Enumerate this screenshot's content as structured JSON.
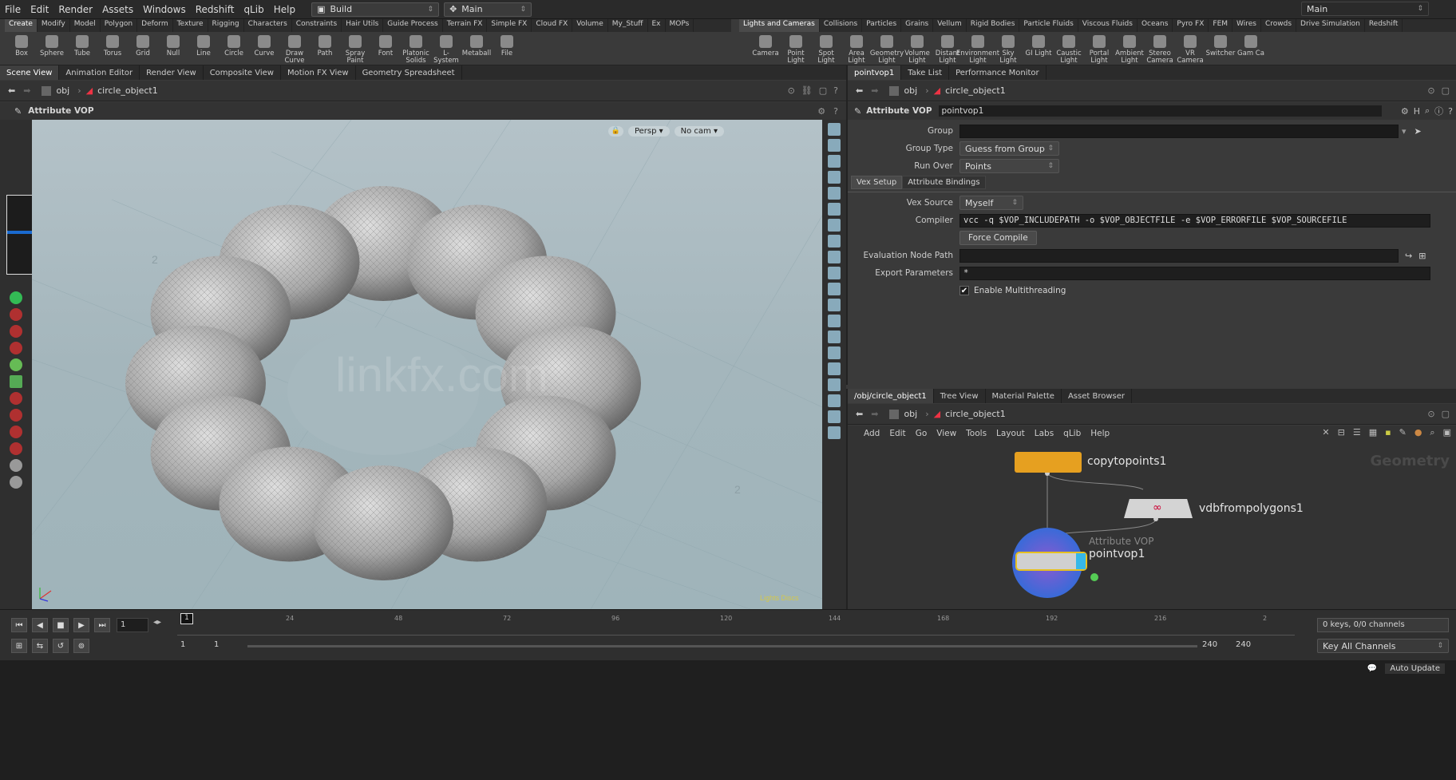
{
  "menubar": {
    "items": [
      "File",
      "Edit",
      "Render",
      "Assets",
      "Windows",
      "Redshift",
      "qLib",
      "Help"
    ],
    "desktop": "Build",
    "desktop_right": "Main",
    "main_center": "Main"
  },
  "shelf_left": {
    "tabs": [
      "Create",
      "Modify",
      "Model",
      "Polygon",
      "Deform",
      "Texture",
      "Rigging",
      "Characters",
      "Constraints",
      "Hair Utils",
      "Guide Process",
      "Terrain FX",
      "Simple FX",
      "Cloud FX",
      "Volume",
      "My_Stuff",
      "Ex",
      "MOPs"
    ],
    "tools": [
      "Box",
      "Sphere",
      "Tube",
      "Torus",
      "Grid",
      "Null",
      "Line",
      "Circle",
      "Curve",
      "Draw Curve",
      "Path",
      "Spray Paint",
      "Font",
      "Platonic Solids",
      "L-System",
      "Metaball",
      "File"
    ]
  },
  "shelf_right": {
    "tabs": [
      "Lights and Cameras",
      "Collisions",
      "Particles",
      "Grains",
      "Vellum",
      "Rigid Bodies",
      "Particle Fluids",
      "Viscous Fluids",
      "Oceans",
      "Pyro FX",
      "FEM",
      "Wires",
      "Crowds",
      "Drive Simulation",
      "Redshift"
    ],
    "tools": [
      "Camera",
      "Point Light",
      "Spot Light",
      "Area Light",
      "Geometry Light",
      "Volume Light",
      "Distant Light",
      "Environment Light",
      "Sky Light",
      "GI Light",
      "Caustic Light",
      "Portal Light",
      "Ambient Light",
      "Stereo Camera",
      "VR Camera",
      "Switcher",
      "Gam Ca"
    ]
  },
  "left_pane": {
    "tabs": [
      "Scene View",
      "Animation Editor",
      "Render View",
      "Composite View",
      "Motion FX View",
      "Geometry Spreadsheet"
    ],
    "path_root": "obj",
    "path_node": "circle_object1",
    "operator": "Attribute VOP",
    "view_persp": "Persp",
    "view_cam": "No cam",
    "watermark": "linkfx.com",
    "grid_numbers": [
      "2",
      "2"
    ],
    "corner_label": "Lights Discs"
  },
  "params_pane": {
    "tabs": [
      "pointvop1",
      "Take List",
      "Performance Monitor"
    ],
    "path_root": "obj",
    "path_node": "circle_object1",
    "node_type": "Attribute VOP",
    "node_name": "pointvop1",
    "group_label": "Group",
    "group_value": "",
    "group_type_label": "Group Type",
    "group_type_value": "Guess from Group",
    "run_over_label": "Run Over",
    "run_over_value": "Points",
    "subtabs": [
      "Vex Setup",
      "Attribute Bindings"
    ],
    "vex_source_label": "Vex Source",
    "vex_source_value": "Myself",
    "compiler_label": "Compiler",
    "compiler_value": "vcc -q $VOP_INCLUDEPATH -o $VOP_OBJECTFILE -e $VOP_ERRORFILE $VOP_SOURCEFILE",
    "force_compile": "Force Compile",
    "eval_path_label": "Evaluation Node Path",
    "eval_path_value": "",
    "export_label": "Export Parameters",
    "export_value": "*",
    "multithread_label": "Enable Multithreading"
  },
  "network_pane": {
    "tabs": [
      "/obj/circle_object1",
      "Tree View",
      "Material Palette",
      "Asset Browser"
    ],
    "path_root": "obj",
    "path_node": "circle_object1",
    "menu": [
      "Add",
      "Edit",
      "Go",
      "View",
      "Tools",
      "Layout",
      "Labs",
      "qLib",
      "Help"
    ],
    "context_label": "Geometry",
    "nodes": {
      "copy": "copytopoints1",
      "vdb": "vdbfrompolygons1",
      "vop_type": "Attribute VOP",
      "vop": "pointvop1"
    }
  },
  "timeline": {
    "frame": "1",
    "ticks": [
      "24",
      "48",
      "72",
      "96",
      "120",
      "144",
      "168",
      "192",
      "216",
      "2"
    ],
    "start": "1",
    "start2": "1",
    "end": "240",
    "end2": "240",
    "keys_info": "0 keys, 0/0 channels",
    "key_channels": "Key All Channels",
    "current_marker": "1"
  },
  "status": {
    "auto_update": "Auto Update"
  },
  "colors": {
    "copy_node": "#e6a020",
    "vop_node_ring": "#3a6ad8",
    "vop_badge": "#36b8e8"
  }
}
